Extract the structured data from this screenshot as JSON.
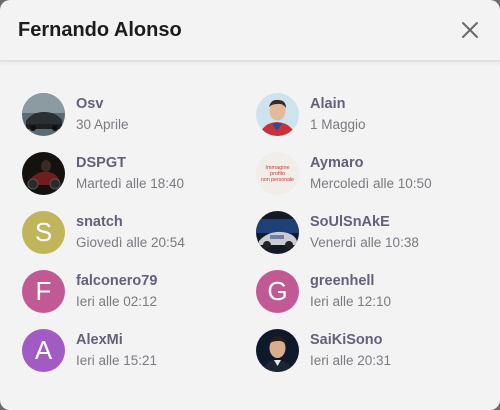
{
  "header": {
    "title": "Fernando Alonso"
  },
  "colors": {
    "olive": "#c0b55a",
    "magenta": "#c15a94",
    "purple": "#a35bc4"
  },
  "people": [
    {
      "name": "Osv",
      "time": "30 Aprile",
      "avatar_type": "photo-car"
    },
    {
      "name": "Alain",
      "time": "1 Maggio",
      "avatar_type": "photo-person"
    },
    {
      "name": "DSPGT",
      "time": "Martedì alle 18:40",
      "avatar_type": "photo-motorbike"
    },
    {
      "name": "Aymaro",
      "time": "Mercoledì alle 10:50",
      "avatar_type": "photo-text",
      "avatar_text": [
        "Immagine",
        "profilo",
        "non personale"
      ]
    },
    {
      "name": "snatch",
      "time": "Giovedì alle 20:54",
      "avatar_type": "letter",
      "letter": "S"
    },
    {
      "name": "SoUlSnAkE",
      "time": "Venerdì alle 10:38",
      "avatar_type": "photo-car-dark"
    },
    {
      "name": "falconero79",
      "time": "Ieri alle 02:12",
      "avatar_type": "letter",
      "letter": "F"
    },
    {
      "name": "greenhell",
      "time": "Ieri alle 12:10",
      "avatar_type": "letter",
      "letter": "G"
    },
    {
      "name": "AlexMi",
      "time": "Ieri alle 15:21",
      "avatar_type": "letter",
      "letter": "A"
    },
    {
      "name": "SaiKiSono",
      "time": "Ieri alle 20:31",
      "avatar_type": "photo-person-dark"
    }
  ]
}
